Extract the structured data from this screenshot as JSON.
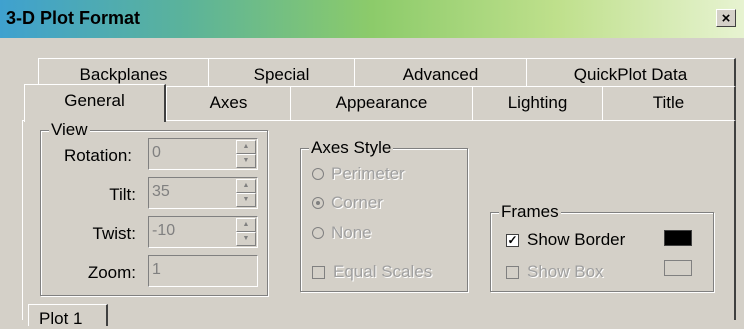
{
  "window": {
    "title": "3-D Plot Format",
    "close_label": "×"
  },
  "tabs_row1": [
    {
      "label": "Backplanes"
    },
    {
      "label": "Special"
    },
    {
      "label": "Advanced"
    },
    {
      "label": "QuickPlot Data"
    }
  ],
  "tabs_row2": [
    {
      "label": "General",
      "active": true
    },
    {
      "label": "Axes"
    },
    {
      "label": "Appearance"
    },
    {
      "label": "Lighting"
    },
    {
      "label": "Title"
    }
  ],
  "view": {
    "legend": "View",
    "rotation": {
      "label": "Rotation:",
      "value": "0"
    },
    "tilt": {
      "label": "Tilt:",
      "value": "35"
    },
    "twist": {
      "label": "Twist:",
      "value": "-10"
    },
    "zoom": {
      "label": "Zoom:",
      "value": "1"
    }
  },
  "axes_style": {
    "legend": "Axes Style",
    "options": [
      {
        "label": "Perimeter",
        "selected": false
      },
      {
        "label": "Corner",
        "selected": true
      },
      {
        "label": "None",
        "selected": false
      }
    ],
    "equal_scales": "Equal Scales"
  },
  "frames": {
    "legend": "Frames",
    "show_border": {
      "label": "Show Border",
      "checked": true,
      "color": "#000000"
    },
    "show_box": {
      "label": "Show Box",
      "checked": false,
      "color": "#d4d0c8"
    }
  },
  "bottom_tab": "Plot 1"
}
